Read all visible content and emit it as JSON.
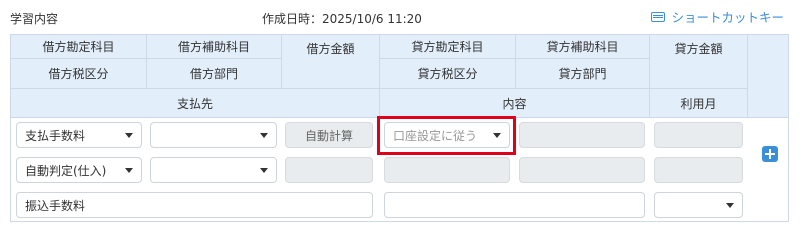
{
  "header": {
    "memo_title": "学習内容",
    "created_label": "作成日時：2025/10/6 11:20",
    "shortcut_label": "ショートカットキー"
  },
  "table_header": {
    "debit_account": "借方勘定科目",
    "debit_sub_account": "借方補助科目",
    "debit_amount": "借方金額",
    "credit_account": "貸方勘定科目",
    "credit_sub_account": "貸方補助科目",
    "credit_amount": "貸方金額",
    "debit_tax": "借方税区分",
    "debit_dept": "借方部門",
    "credit_tax": "貸方税区分",
    "credit_dept": "貸方部門",
    "payee": "支払先",
    "description": "内容",
    "usage_month": "利用月"
  },
  "row": {
    "debit_account_value": "支払手数料",
    "debit_sub_account_value": "",
    "debit_amount_value": "自動計算",
    "credit_account_value": "口座設定に従う",
    "debit_tax_value": "自動判定(仕入)",
    "debit_dept_value": "",
    "payee_value": "振込手数料",
    "description_value": "",
    "usage_month_value": ""
  },
  "colors": {
    "header_bg": "#e3eefb",
    "highlight": "#e0001b",
    "accent": "#3b8fd8"
  },
  "icons": {
    "shortcut": "keyboard-icon",
    "add": "plus-icon"
  }
}
